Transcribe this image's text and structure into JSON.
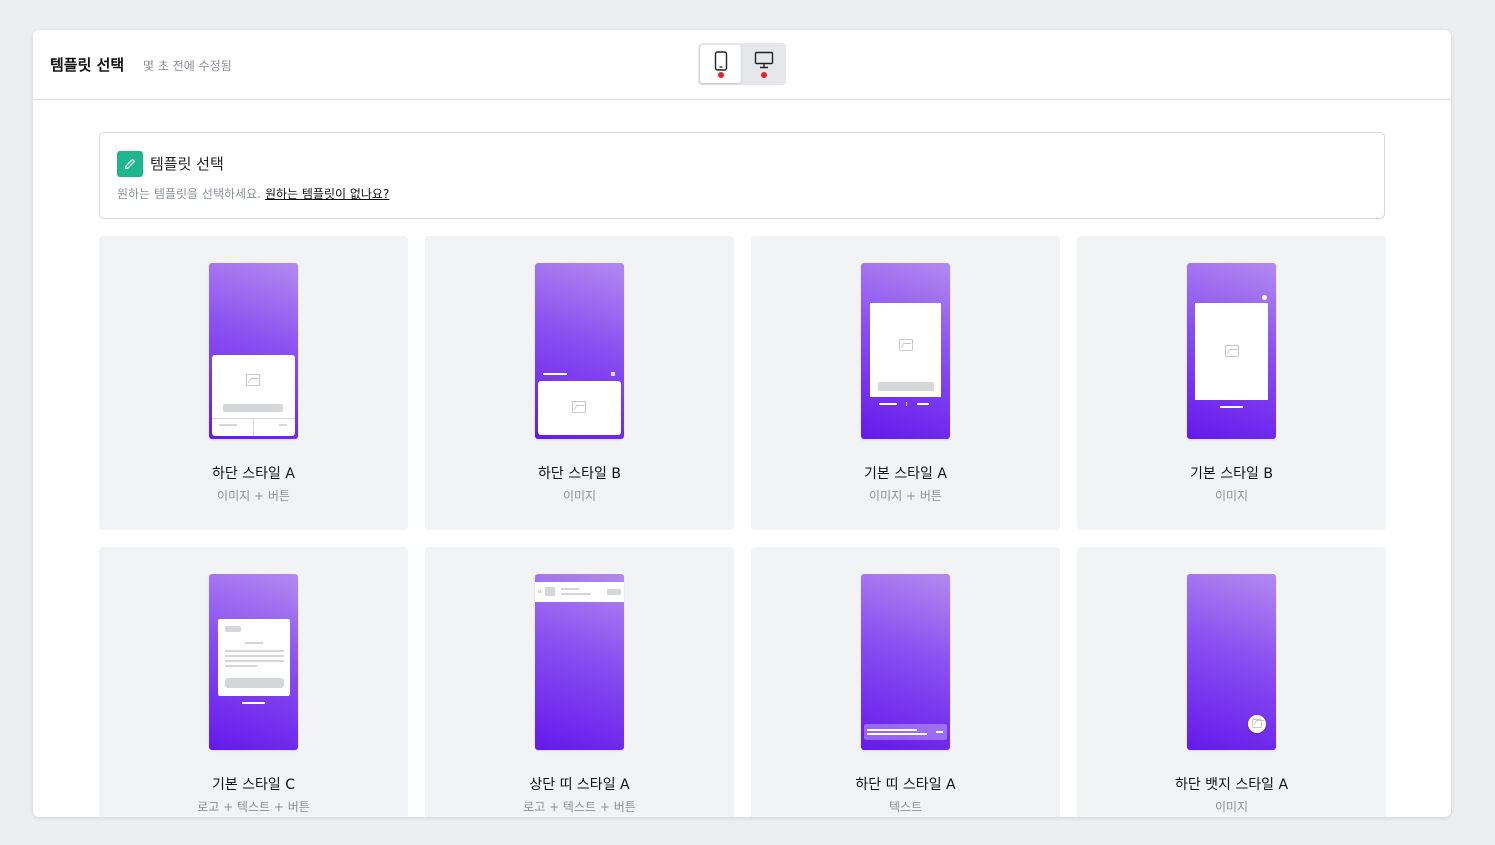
{
  "header": {
    "title": "템플릿 선택",
    "subtitle": "몇 초 전에 수정됨",
    "device_mobile_icon": "mobile-icon",
    "device_desktop_icon": "desktop-icon"
  },
  "panel": {
    "icon": "pencil-icon",
    "title": "템플릿 선택",
    "description": "원하는 템플릿을 선택하세요.",
    "link": "원하는 템플릿이 없나요?"
  },
  "templates": [
    {
      "title": "하단 스타일 A",
      "subtitle": "이미지 + 버튼"
    },
    {
      "title": "하단 스타일 B",
      "subtitle": "이미지"
    },
    {
      "title": "기본 스타일 A",
      "subtitle": "이미지 + 버튼"
    },
    {
      "title": "기본 스타일 B",
      "subtitle": "이미지"
    },
    {
      "title": "기본 스타일 C",
      "subtitle": "로고 + 텍스트 + 버튼"
    },
    {
      "title": "상단 띠 스타일 A",
      "subtitle": "로고 + 텍스트 + 버튼"
    },
    {
      "title": "하단 띠 스타일 A",
      "subtitle": "텍스트"
    },
    {
      "title": "하단 뱃지 스타일 A",
      "subtitle": "이미지"
    }
  ],
  "colors": {
    "accent": "#1fb68e",
    "alert_dot": "#e02424",
    "gradient_top": "#b28af0",
    "gradient_bottom": "#6419ec"
  }
}
